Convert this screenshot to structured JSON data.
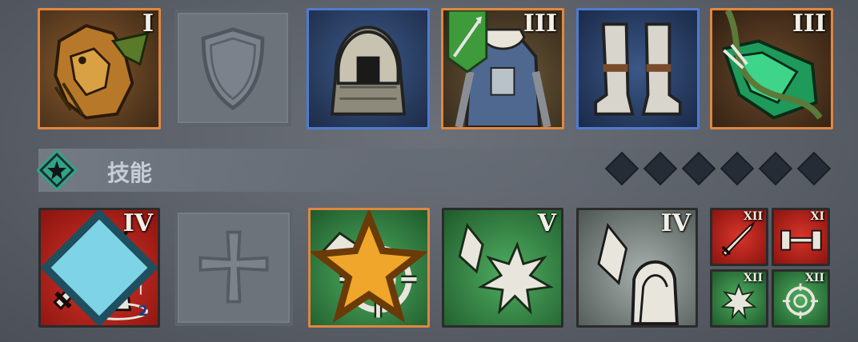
{
  "equipment": {
    "slots": [
      {
        "name": "dragon-trinket",
        "tier": "I",
        "rarity": "orange"
      },
      {
        "name": "shield",
        "tier": "",
        "rarity": "empty"
      },
      {
        "name": "helmet",
        "tier": "",
        "rarity": "blue"
      },
      {
        "name": "armor",
        "tier": "III",
        "rarity": "orange"
      },
      {
        "name": "boots",
        "tier": "",
        "rarity": "blue"
      },
      {
        "name": "crystal-amulet",
        "tier": "III",
        "rarity": "orange"
      }
    ]
  },
  "skills_section": {
    "title": "技能",
    "slot_dots": 6
  },
  "skills": [
    {
      "name": "sword-aura",
      "tier": "IV",
      "badge": "2"
    },
    {
      "name": "empty-cross",
      "tier": ""
    },
    {
      "name": "target-shot",
      "tier": "",
      "starred": true
    },
    {
      "name": "crystal-burst",
      "tier": "V"
    },
    {
      "name": "crystal-guard",
      "tier": "IV"
    }
  ],
  "passives": [
    {
      "name": "sword-passive",
      "tier": "XII"
    },
    {
      "name": "dumbbell-passive",
      "tier": "XI"
    },
    {
      "name": "burst-passive",
      "tier": "XII"
    },
    {
      "name": "target-passive",
      "tier": "XII"
    }
  ],
  "colors": {
    "orange_frame": "#e0873f",
    "blue_frame": "#4f7bd0",
    "red_skill": "#b8231c",
    "green_skill": "#3f8a4e",
    "teal_accent": "#2fa487"
  }
}
